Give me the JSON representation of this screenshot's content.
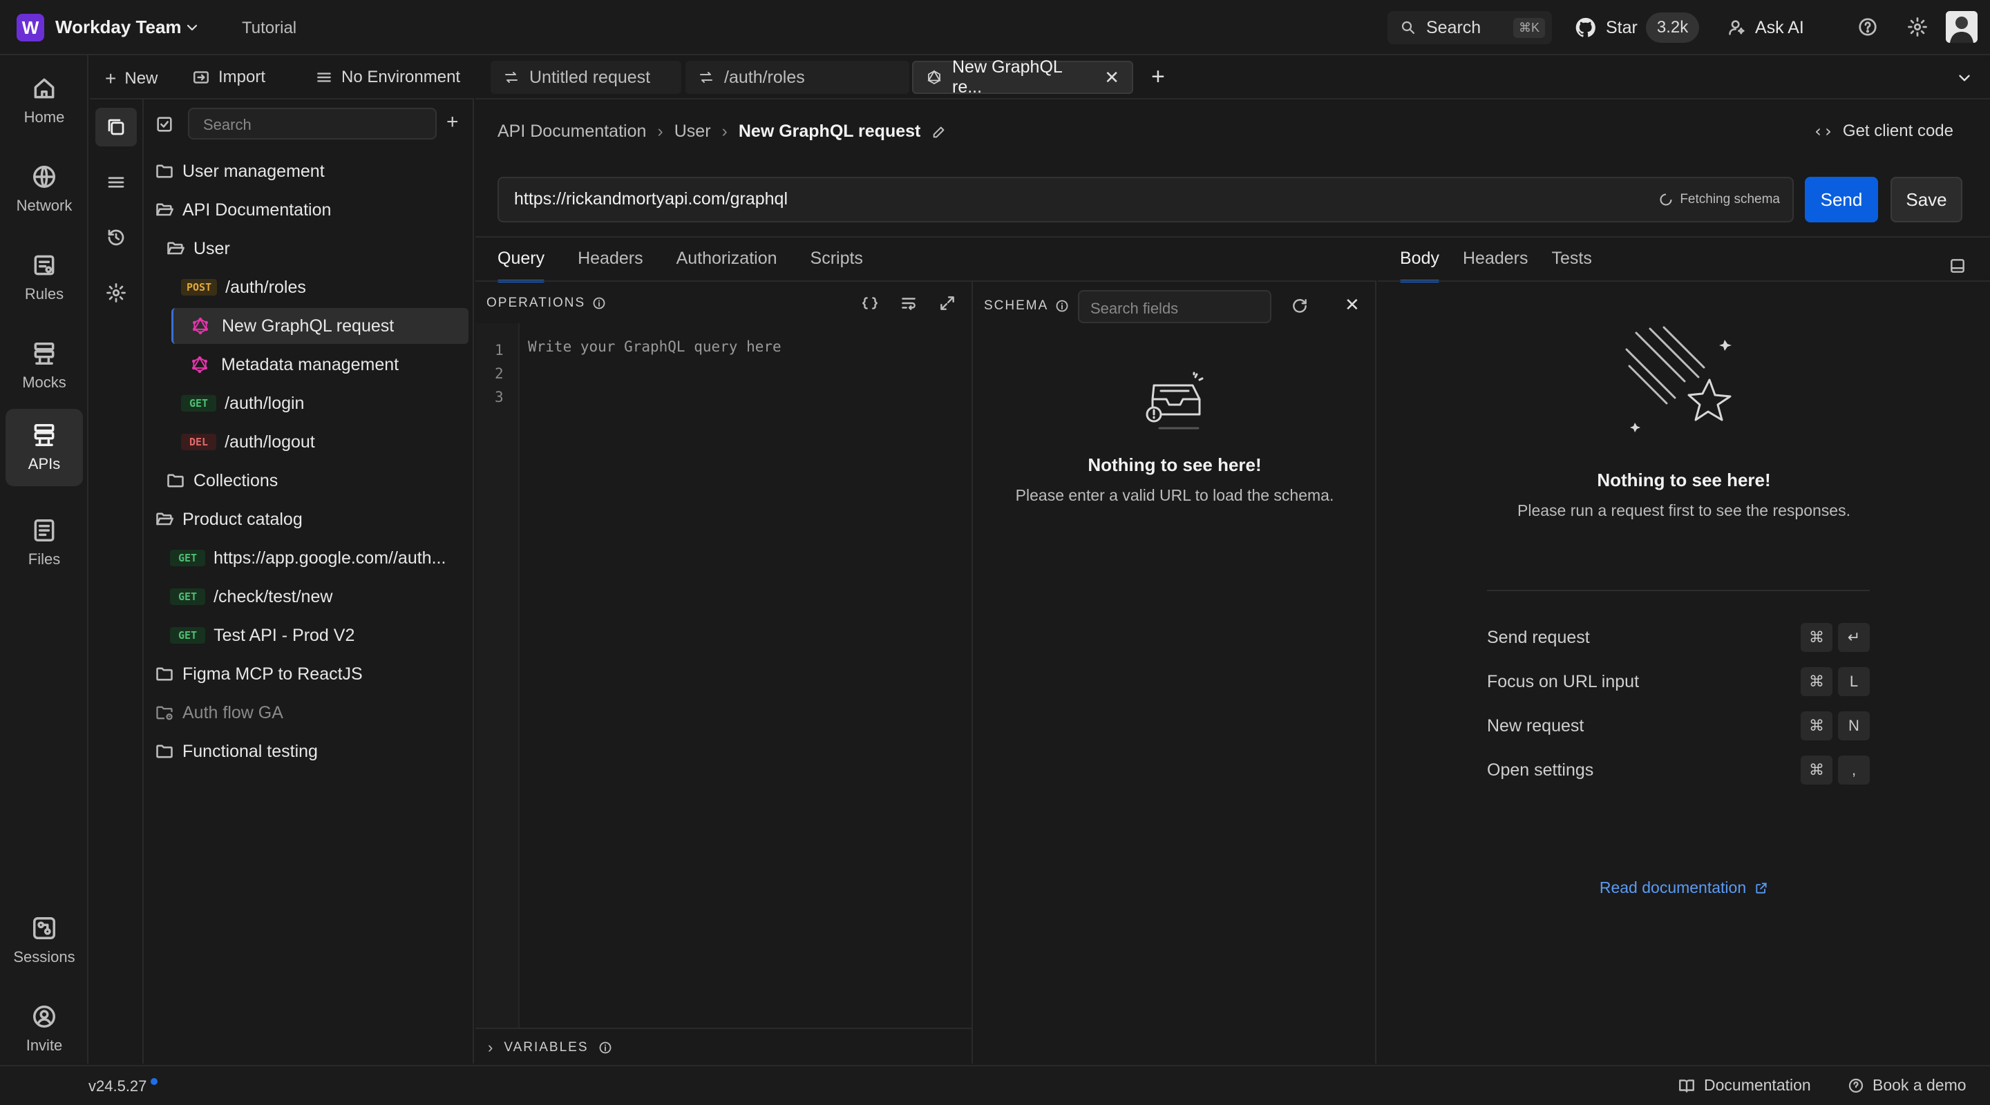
{
  "workspace": {
    "logo_letter": "W",
    "name": "Workday Team",
    "tutorial": "Tutorial"
  },
  "topbar": {
    "search_label": "Search",
    "search_shortcut": "⌘K",
    "star_label": "Star",
    "star_count": "3.2k",
    "ask_ai": "Ask AI"
  },
  "rail": [
    {
      "label": "Home",
      "icon": "home-icon"
    },
    {
      "label": "Network",
      "icon": "globe-icon"
    },
    {
      "label": "Rules",
      "icon": "rules-icon"
    },
    {
      "label": "Mocks",
      "icon": "mocks-icon"
    },
    {
      "label": "APIs",
      "icon": "apis-icon",
      "active": true
    },
    {
      "label": "Files",
      "icon": "files-icon"
    },
    {
      "label": "Sessions",
      "icon": "sessions-icon"
    },
    {
      "label": "Invite",
      "icon": "invite-icon"
    }
  ],
  "sidebar": {
    "new_label": "New",
    "import_label": "Import",
    "environment": "No Environment",
    "search_placeholder": "Search",
    "tree": [
      {
        "type": "folder",
        "label": "User management"
      },
      {
        "type": "folder-open",
        "label": "API Documentation"
      },
      {
        "type": "folder-open",
        "label": "User"
      },
      {
        "type": "request",
        "method": "POST",
        "label": "/auth/roles"
      },
      {
        "type": "graphql",
        "label": "New GraphQL request",
        "selected": true
      },
      {
        "type": "graphql",
        "label": "Metadata management"
      },
      {
        "type": "request",
        "method": "GET",
        "label": "/auth/login"
      },
      {
        "type": "request",
        "method": "DEL",
        "label": "/auth/logout"
      },
      {
        "type": "folder",
        "label": "Collections"
      },
      {
        "type": "folder-open",
        "label": "Product catalog"
      },
      {
        "type": "request",
        "method": "GET",
        "label": "https://app.google.com//auth..."
      },
      {
        "type": "request",
        "method": "GET",
        "label": "/check/test/new"
      },
      {
        "type": "request",
        "method": "GET",
        "label": "Test API - Prod V2"
      },
      {
        "type": "folder",
        "label": "Figma MCP to ReactJS"
      },
      {
        "type": "folder-lock",
        "label": "Auth flow GA",
        "dim": true
      },
      {
        "type": "folder",
        "label": "Functional testing"
      }
    ]
  },
  "tabs": [
    {
      "label": "Untitled request"
    },
    {
      "label": "/auth/roles"
    },
    {
      "label": "New GraphQL re...",
      "active": true
    }
  ],
  "request": {
    "breadcrumb": [
      "API Documentation",
      "User",
      "New GraphQL request"
    ],
    "get_client_code": "Get client code",
    "url": "https://rickandmortyapi.com/graphql",
    "fetching": "Fetching schema",
    "send": "Send",
    "save": "Save",
    "subtabs": [
      "Query",
      "Headers",
      "Authorization",
      "Scripts"
    ]
  },
  "operations": {
    "title": "OPERATIONS",
    "line_numbers": [
      "1",
      "2",
      "3"
    ],
    "placeholder": "Write your GraphQL query here",
    "variables": "VARIABLES"
  },
  "schema": {
    "title": "SCHEMA",
    "search_placeholder": "Search fields",
    "empty_title": "Nothing to see here!",
    "empty_text": "Please enter a valid URL to load the schema."
  },
  "response": {
    "tabs": [
      "Body",
      "Headers",
      "Tests"
    ],
    "empty_title": "Nothing to see here!",
    "empty_text": "Please run a request first to see the responses.",
    "shortcuts": [
      {
        "label": "Send request",
        "keys": [
          "⌘",
          "↵"
        ]
      },
      {
        "label": "Focus on URL input",
        "keys": [
          "⌘",
          "L"
        ]
      },
      {
        "label": "New request",
        "keys": [
          "⌘",
          "N"
        ]
      },
      {
        "label": "Open settings",
        "keys": [
          "⌘",
          ","
        ]
      }
    ],
    "read_docs": "Read documentation"
  },
  "statusbar": {
    "version": "v24.5.27",
    "documentation": "Documentation",
    "book_demo": "Book a demo"
  },
  "colors": {
    "accent": "#0a5fe0",
    "brand": "#6b2fd6",
    "link": "#5b9bf5"
  }
}
